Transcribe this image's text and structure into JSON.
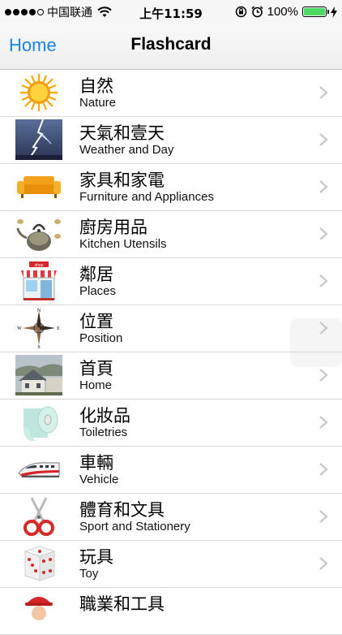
{
  "status_bar": {
    "carrier": "中国联通",
    "time": "上午11:59",
    "battery_percent": "100%",
    "signal_bars": 4,
    "signal_total": 5,
    "battery_level": 1.0
  },
  "nav": {
    "back_label": "Home",
    "title": "Flashcard"
  },
  "colors": {
    "accent": "#1a83e6",
    "battery": "#4cd964"
  },
  "categories": [
    {
      "zh": "自然",
      "en": "Nature",
      "icon": "sun-icon"
    },
    {
      "zh": "天氣和壹天",
      "en": "Weather and Day",
      "icon": "lightning-icon"
    },
    {
      "zh": "家具和家電",
      "en": "Furniture and Appliances",
      "icon": "sofa-icon"
    },
    {
      "zh": "廚房用品",
      "en": "Kitchen Utensils",
      "icon": "teapot-icon"
    },
    {
      "zh": "鄰居",
      "en": "Places",
      "icon": "shop-icon"
    },
    {
      "zh": "位置",
      "en": "Position",
      "icon": "compass-icon"
    },
    {
      "zh": "首頁",
      "en": "Home",
      "icon": "house-icon"
    },
    {
      "zh": "化妝品",
      "en": "Toiletries",
      "icon": "toilet-paper-icon"
    },
    {
      "zh": "車輛",
      "en": "Vehicle",
      "icon": "train-icon"
    },
    {
      "zh": "體育和文具",
      "en": "Sport and Stationery",
      "icon": "scissors-icon"
    },
    {
      "zh": "玩具",
      "en": "Toy",
      "icon": "dice-icon"
    },
    {
      "zh": "職業和工具",
      "en": "",
      "icon": "worker-icon"
    }
  ]
}
